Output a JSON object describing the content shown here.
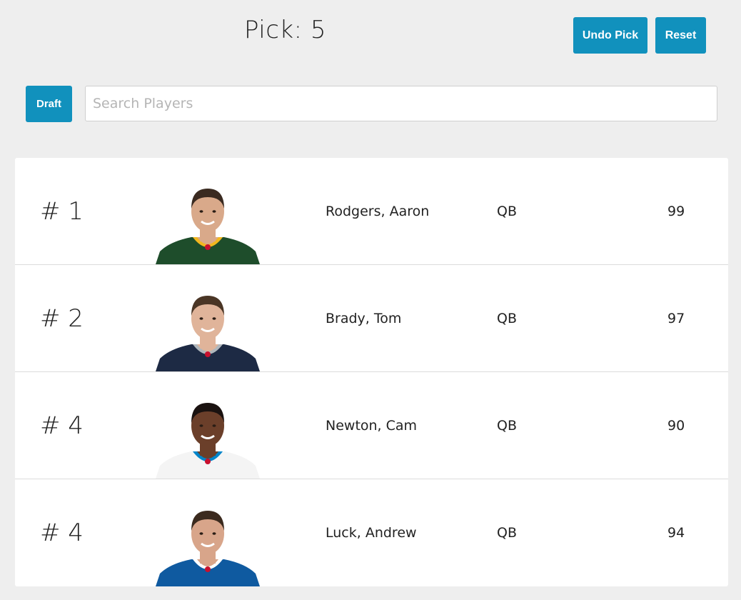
{
  "header": {
    "pick_label": "Pick: 5"
  },
  "toolbar": {
    "undo_label": "Undo Pick",
    "reset_label": "Reset",
    "draft_label": "Draft"
  },
  "search": {
    "placeholder": "Search Players",
    "value": ""
  },
  "players": [
    {
      "rank": "# 1",
      "name": "Rodgers, Aaron",
      "position": "QB",
      "rating": "99",
      "jersey": "#1e4d2b",
      "trim": "#f2b71f",
      "skin": "#d9a98a",
      "hair": "#3a2a20"
    },
    {
      "rank": "# 2",
      "name": "Brady, Tom",
      "position": "QB",
      "rating": "97",
      "jersey": "#1d2a44",
      "trim": "#b0b7bc",
      "skin": "#e0b49a",
      "hair": "#4a3525"
    },
    {
      "rank": "# 4",
      "name": "Newton, Cam",
      "position": "QB",
      "rating": "90",
      "jersey": "#f4f4f4",
      "trim": "#0085ca",
      "skin": "#6b3f2a",
      "hair": "#1a1210"
    },
    {
      "rank": "# 4",
      "name": "Luck, Andrew",
      "position": "QB",
      "rating": "94",
      "jersey": "#0f5aa0",
      "trim": "#ffffff",
      "skin": "#d8a58a",
      "hair": "#3b2a1e"
    }
  ]
}
